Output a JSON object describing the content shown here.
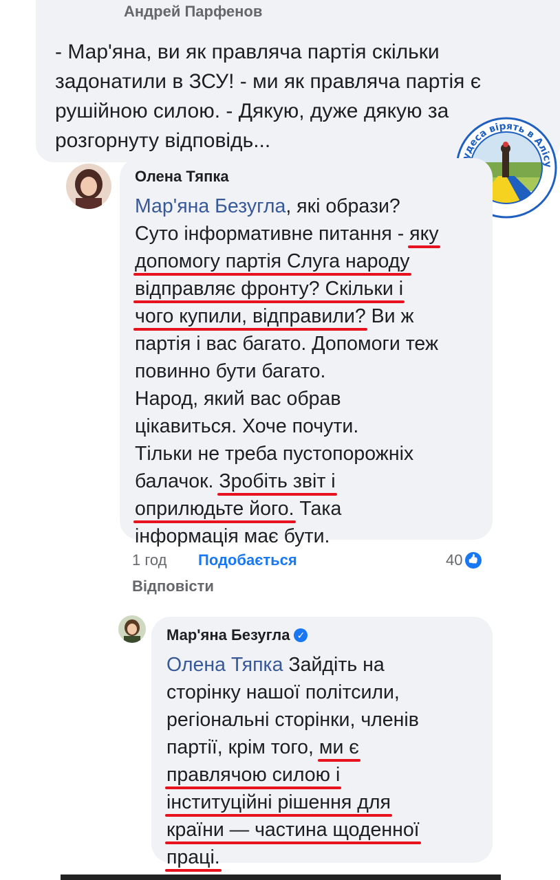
{
  "top_comment": {
    "author": "Андрей Парфенов",
    "lines": [
      "- Мар'яна, ви як правляча партія скільки",
      "задонатили в ЗСУ! - ми як правляча партія є",
      "рушійною силою. - Дякую, дуже дякую за",
      "розгорнуту відповідь..."
    ]
  },
  "watermark": {
    "text": "Чудеса вірять в Алісу",
    "colors": {
      "blue": "#1f5fbf",
      "yellow": "#f4d21f"
    }
  },
  "comment_olena": {
    "author": "Олена Тяпка",
    "mention": "Мар'яна Безугла",
    "l1_rest": ", які образи?",
    "l2a": "Суто інформативне питання - ",
    "l2b": "яку",
    "l3": "допомогу партія Слуга народу",
    "l4": "відправляє фронту? Скільки і",
    "l5a": "чого купили, відправили?",
    "l5b": " Ви ж",
    "l6": "партія і вас багато. Допомоги теж",
    "l7": "повинно бути багато.",
    "l8": "Народ, який вас обрав",
    "l9": "цікавиться. Хоче почути.",
    "l10": "Тільки не треба пустопорожніх",
    "l11a": "балачок. ",
    "l11b": "Зробіть звіт і",
    "l12a": "оприлюдьте його.",
    "l12b": " Така",
    "l13": "інформація має бути.",
    "time": "1 год",
    "like_label": "Подобається",
    "reactions": "40",
    "reply_label": "Відповісти"
  },
  "comment_maryana": {
    "author": "Мар'яна Безугла",
    "verified": "✓",
    "mention": "Олена Тяпка",
    "l1_rest": " Зайдіть на",
    "l2": "сторінку нашої політсили,",
    "l3": "регіональні сторінки, членів",
    "l4a": "партії, крім того, ",
    "l4b": "ми є",
    "l5": "правлячою силою і",
    "l6": "інституційні рішення для",
    "l7": "країни — частина щоденної",
    "l8": "праці."
  },
  "accent_colors": {
    "link": "#1877f2",
    "mention": "#385898",
    "underline": "#e8121f"
  }
}
